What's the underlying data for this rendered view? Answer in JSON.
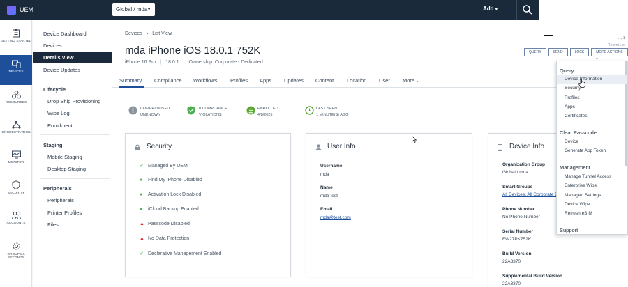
{
  "topbar": {
    "app_name": "UEM",
    "scope": "Global / mda",
    "add_label": "Add"
  },
  "leftnav": {
    "items": [
      {
        "label": "Getting Started",
        "icon": "clipboard-icon"
      },
      {
        "label": "Devices",
        "icon": "devices-icon"
      },
      {
        "label": "Resources",
        "icon": "resources-icon"
      },
      {
        "label": "Orchestration",
        "icon": "orchestration-icon"
      },
      {
        "label": "Monitor",
        "icon": "monitor-icon"
      },
      {
        "label": "Security",
        "icon": "shield-icon"
      },
      {
        "label": "Accounts",
        "icon": "accounts-icon"
      },
      {
        "label": "Groups & Settings",
        "icon": "gear-icon"
      }
    ]
  },
  "subnav": {
    "device_dashboard": "Device Dashboard",
    "devices": "Devices",
    "details_view": "Details View",
    "device_updates": "Device Updates",
    "lifecycle": "Lifecycle",
    "drop_ship": "Drop Ship Provisioning",
    "wipe_log": "Wipe Log",
    "enrollment": "Enrollment",
    "staging": "Staging",
    "mobile_staging": "Mobile Staging",
    "desktop_staging": "Desktop Staging",
    "peripherals": "Peripherals",
    "peripherals_item": "Peripherals",
    "printer_profiles": "Printer Profiles",
    "files": "Files"
  },
  "header": {
    "breadcrumb_devices": "Devices",
    "breadcrumb_list": "List View",
    "title": "mda iPhone iOS 18.0.1 752K",
    "model": "iPhone 16 Pro",
    "os": "18.0.1",
    "ownership": "Ownership: Corporate - Dedicated",
    "recent_label": "Recent List",
    "recent_top": ".  ,  1"
  },
  "actions": {
    "query": "Query",
    "send": "Send",
    "lock": "Lock",
    "more": "More Actions ▾"
  },
  "tabs": [
    "Summary",
    "Compliance",
    "Workflows",
    "Profiles",
    "Apps",
    "Updates",
    "Content",
    "Location",
    "User",
    "More"
  ],
  "status": {
    "compromised_1": "Compromised:",
    "compromised_2": "Unknown",
    "compliance_1": "0 Compliance",
    "compliance_2": "Violations",
    "enrolled_1": "Enrolled",
    "enrolled_2": "4/8/2025",
    "lastseen_1": "Last Seen",
    "lastseen_2": "1 Minute(s) Ago"
  },
  "security": {
    "title": "Security",
    "rows": [
      {
        "label": "Managed By UEM",
        "status": "ok"
      },
      {
        "label": "Find My iPhone Disabled",
        "status": "dot"
      },
      {
        "label": "Activation Lock Disabled",
        "status": "dot"
      },
      {
        "label": "iCloud Backup Enabled",
        "status": "dot"
      },
      {
        "label": "Passcode Disabled",
        "status": "warn"
      },
      {
        "label": "No Data Protection",
        "status": "warn"
      },
      {
        "label": "Declarative Management Enabled",
        "status": "ok"
      }
    ]
  },
  "user_info": {
    "title": "User Info",
    "username_label": "Username",
    "username": "mda",
    "name_label": "Name",
    "name": "mda test",
    "email_label": "Email",
    "email": "mda@test.com"
  },
  "device_info": {
    "title": "Device Info",
    "org_label": "Organization Group",
    "org": "Global / mda",
    "smart_label": "Smart Groups",
    "smart": "All Devices, All Corporate D",
    "phone_label": "Phone Number",
    "phone": "No Phone Number",
    "serial_label": "Serial Number",
    "serial": "FW27PK752K",
    "build_label": "Build Version",
    "build": "22A3370",
    "supp_label": "Supplemental Build Version",
    "supp": "22A3370"
  },
  "dropdown": {
    "query": "Query",
    "query_items": [
      "Device Information",
      "Security",
      "Profiles",
      "Apps",
      "Certificates"
    ],
    "clear_passcode": "Clear Passcode",
    "clear_items": [
      "Device",
      "Generate App Token"
    ],
    "management": "Management",
    "management_items": [
      "Manage Tunnel Access",
      "Enterprise Wipe",
      "Managed Settings",
      "Device Wipe",
      "Refresh eSIM"
    ],
    "support": "Support"
  }
}
